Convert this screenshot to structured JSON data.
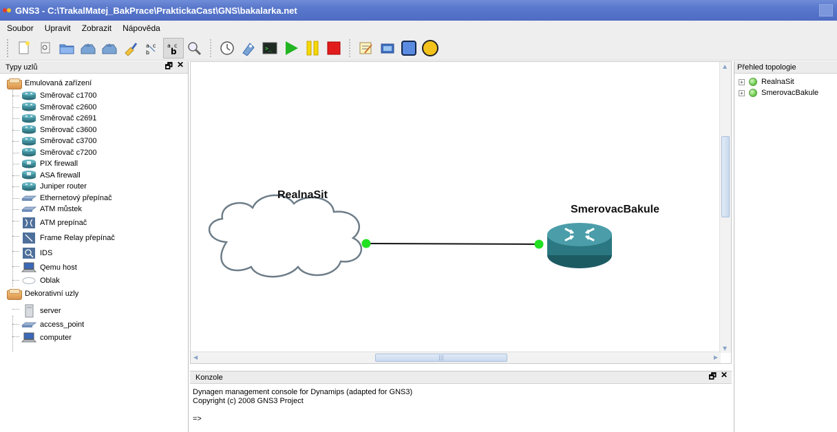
{
  "window": {
    "title": "GNS3 - C:\\TrakalMatej_BakPrace\\PraktickaCast\\GNS\\bakalarka.net"
  },
  "menu": [
    "Soubor",
    "Upravit",
    "Zobrazit",
    "Nápověda"
  ],
  "toolbar": {
    "icons": [
      "new-file-icon",
      "open-icon",
      "folder-icon",
      "save-icon",
      "save-as-icon",
      "clear-icon",
      "show-interface-labels-icon",
      "show-hostnames-icon",
      "zoom-icon",
      "snapshot-icon",
      "capture-icon",
      "console-icon",
      "start-icon",
      "pause-icon",
      "stop-icon",
      "add-note-icon",
      "insert-picture-icon",
      "draw-rectangle-icon",
      "draw-ellipse-icon"
    ],
    "colors": {
      "start": "#22b422",
      "pause": "#f5d800",
      "stop": "#e21c1c",
      "ellipse": "#f3c21b",
      "rectangle": "#5a8be0"
    }
  },
  "left_panel": {
    "title": "Typy uzlů",
    "categories": [
      {
        "label": "Emulovaná zařízení",
        "items": [
          {
            "label": "Směrovač c1700",
            "icon": "router-icon"
          },
          {
            "label": "Směrovač c2600",
            "icon": "router-icon"
          },
          {
            "label": "Směrovač c2691",
            "icon": "router-icon"
          },
          {
            "label": "Směrovač c3600",
            "icon": "router-icon"
          },
          {
            "label": "Směrovač c3700",
            "icon": "router-icon"
          },
          {
            "label": "Směrovač c7200",
            "icon": "router-icon"
          },
          {
            "label": "PIX firewall",
            "icon": "firewall-icon"
          },
          {
            "label": "ASA firewall",
            "icon": "firewall-icon"
          },
          {
            "label": "Juniper router",
            "icon": "router-icon"
          },
          {
            "label": "Ethernetový přepínač",
            "icon": "switch-icon"
          },
          {
            "label": "ATM můstek",
            "icon": "bridge-icon"
          },
          {
            "label": "ATM prepínač",
            "icon": "atm-switch-icon"
          },
          {
            "label": "Frame Relay přepínač",
            "icon": "frame-relay-icon"
          },
          {
            "label": "IDS",
            "icon": "ids-icon"
          },
          {
            "label": "Qemu host",
            "icon": "computer-icon"
          },
          {
            "label": "Oblak",
            "icon": "cloud-icon"
          }
        ]
      },
      {
        "label": "Dekorativní uzly",
        "items": [
          {
            "label": "server",
            "icon": "server-icon"
          },
          {
            "label": "access_point",
            "icon": "access-point-icon"
          },
          {
            "label": "computer",
            "icon": "computer-icon"
          }
        ]
      }
    ]
  },
  "canvas": {
    "nodes": [
      {
        "label": "RealnaSit",
        "type": "cloud-icon"
      },
      {
        "label": "SmerovacBakule",
        "type": "router-icon"
      }
    ],
    "link_endpoint_color": "#22e022"
  },
  "console": {
    "title": "Konzole",
    "lines": [
      "Dynagen management console for Dynamips (adapted for GNS3)",
      "Copyright (c) 2008 GNS3 Project"
    ],
    "prompt": "=>"
  },
  "right_panel": {
    "title": "Přehled topologie",
    "items": [
      "RealnaSit",
      "SmerovacBakule"
    ]
  },
  "dock_controls": {
    "float": "🗗",
    "close": "✕"
  }
}
